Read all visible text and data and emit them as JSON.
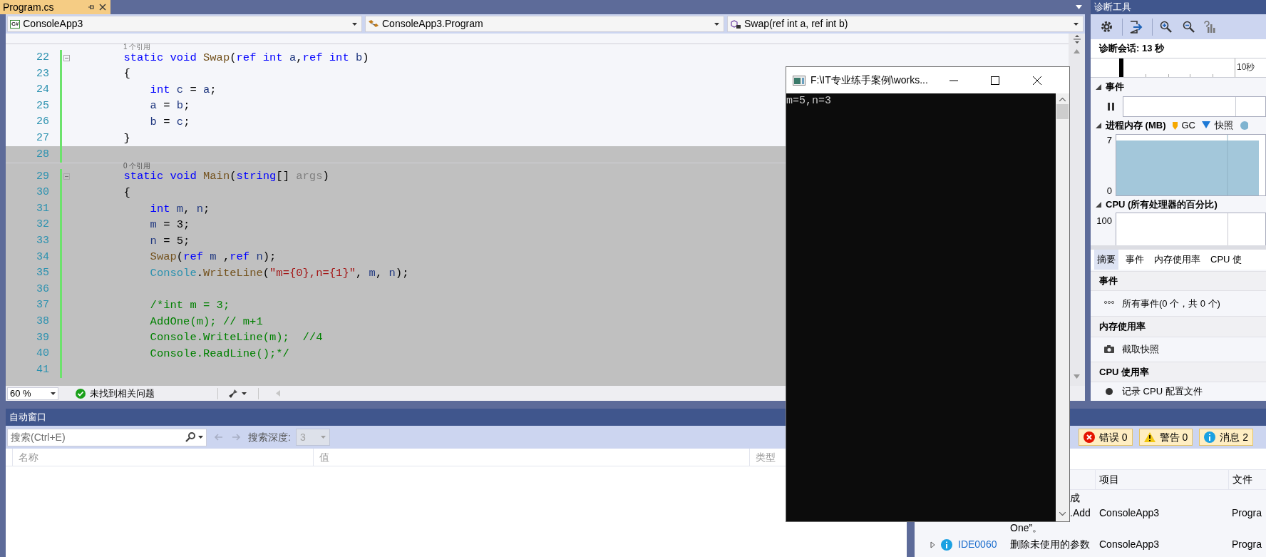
{
  "document_tabs": [
    {
      "title": "Program.cs",
      "selected": true
    }
  ],
  "navigation_bar": {
    "project_badge": "C#",
    "project": "ConsoleApp3",
    "type": "ConsoleApp3.Program",
    "member": "Swap(ref int a, ref int b)"
  },
  "editor": {
    "lines": [
      {
        "kind": "codelens",
        "text": "1 个引用",
        "selected": false
      },
      {
        "kind": "code",
        "number": "22",
        "changed": true,
        "selected": false,
        "foldable": true,
        "tokens": [
          {
            "text": "        static void ",
            "kind": "keyword"
          },
          {
            "text": "Swap",
            "kind": "method"
          },
          {
            "text": "(",
            "kind": "plain"
          },
          {
            "text": "ref int ",
            "kind": "keyword"
          },
          {
            "text": "a",
            "kind": "local"
          },
          {
            "text": ",",
            "kind": "plain"
          },
          {
            "text": "ref int ",
            "kind": "keyword"
          },
          {
            "text": "b",
            "kind": "local"
          },
          {
            "text": ")",
            "kind": "plain"
          }
        ]
      },
      {
        "kind": "code",
        "number": "23",
        "changed": true,
        "selected": false,
        "foldable": false,
        "tokens": [
          {
            "text": "        {",
            "kind": "plain"
          }
        ]
      },
      {
        "kind": "code",
        "number": "24",
        "changed": true,
        "selected": false,
        "foldable": false,
        "tokens": [
          {
            "text": "            int ",
            "kind": "keyword"
          },
          {
            "text": "c",
            "kind": "local"
          },
          {
            "text": " = ",
            "kind": "plain"
          },
          {
            "text": "a",
            "kind": "local"
          },
          {
            "text": ";",
            "kind": "plain"
          }
        ]
      },
      {
        "kind": "code",
        "number": "25",
        "changed": true,
        "selected": false,
        "foldable": false,
        "tokens": [
          {
            "text": "            a",
            "kind": "local"
          },
          {
            "text": " = ",
            "kind": "plain"
          },
          {
            "text": "b",
            "kind": "local"
          },
          {
            "text": ";",
            "kind": "plain"
          }
        ]
      },
      {
        "kind": "code",
        "number": "26",
        "changed": true,
        "selected": false,
        "foldable": false,
        "tokens": [
          {
            "text": "            b",
            "kind": "local"
          },
          {
            "text": " = ",
            "kind": "plain"
          },
          {
            "text": "c",
            "kind": "local"
          },
          {
            "text": ";",
            "kind": "plain"
          }
        ]
      },
      {
        "kind": "code",
        "number": "27",
        "changed": true,
        "selected": false,
        "foldable": false,
        "tokens": [
          {
            "text": "        }",
            "kind": "plain"
          }
        ]
      },
      {
        "kind": "code",
        "number": "28",
        "changed": true,
        "selected": true,
        "foldable": false
      },
      {
        "kind": "codelens",
        "text": "0 个引用",
        "selected": true
      },
      {
        "kind": "code",
        "number": "29",
        "changed": true,
        "selected": true,
        "foldable": true,
        "tokens": [
          {
            "text": "        static void ",
            "kind": "keyword"
          },
          {
            "text": "Main",
            "kind": "method"
          },
          {
            "text": "(",
            "kind": "plain"
          },
          {
            "text": "string",
            "kind": "keyword"
          },
          {
            "text": "[] ",
            "kind": "plain"
          },
          {
            "text": "args",
            "kind": "unused"
          },
          {
            "text": ")",
            "kind": "plain"
          }
        ]
      },
      {
        "kind": "code",
        "number": "30",
        "changed": true,
        "selected": true,
        "foldable": false,
        "tokens": [
          {
            "text": "        {",
            "kind": "plain"
          }
        ]
      },
      {
        "kind": "code",
        "number": "31",
        "changed": true,
        "selected": true,
        "foldable": false,
        "tokens": [
          {
            "text": "            int ",
            "kind": "keyword"
          },
          {
            "text": "m",
            "kind": "local"
          },
          {
            "text": ", ",
            "kind": "plain"
          },
          {
            "text": "n",
            "kind": "local"
          },
          {
            "text": ";",
            "kind": "plain"
          }
        ]
      },
      {
        "kind": "code",
        "number": "32",
        "changed": true,
        "selected": true,
        "foldable": false,
        "tokens": [
          {
            "text": "            m",
            "kind": "local"
          },
          {
            "text": " = 3;",
            "kind": "plain"
          }
        ]
      },
      {
        "kind": "code",
        "number": "33",
        "changed": true,
        "selected": true,
        "foldable": false,
        "tokens": [
          {
            "text": "            n",
            "kind": "local"
          },
          {
            "text": " = 5;",
            "kind": "plain"
          }
        ]
      },
      {
        "kind": "code",
        "number": "34",
        "changed": true,
        "selected": true,
        "foldable": false,
        "tokens": [
          {
            "text": "            Swap",
            "kind": "method"
          },
          {
            "text": "(",
            "kind": "plain"
          },
          {
            "text": "ref ",
            "kind": "keyword"
          },
          {
            "text": "m",
            "kind": "local"
          },
          {
            "text": " ,",
            "kind": "plain"
          },
          {
            "text": "ref ",
            "kind": "keyword"
          },
          {
            "text": "n",
            "kind": "local"
          },
          {
            "text": ");",
            "kind": "plain"
          }
        ]
      },
      {
        "kind": "code",
        "number": "35",
        "changed": true,
        "selected": true,
        "foldable": false,
        "tokens": [
          {
            "text": "            Console",
            "kind": "type"
          },
          {
            "text": ".",
            "kind": "plain"
          },
          {
            "text": "WriteLine",
            "kind": "method"
          },
          {
            "text": "(",
            "kind": "plain"
          },
          {
            "text": "\"m={0},n={1}\"",
            "kind": "string"
          },
          {
            "text": ", ",
            "kind": "plain"
          },
          {
            "text": "m",
            "kind": "local"
          },
          {
            "text": ", ",
            "kind": "plain"
          },
          {
            "text": "n",
            "kind": "local"
          },
          {
            "text": ");",
            "kind": "plain"
          }
        ]
      },
      {
        "kind": "code",
        "number": "36",
        "changed": true,
        "selected": true,
        "foldable": false
      },
      {
        "kind": "code",
        "number": "37",
        "changed": true,
        "selected": true,
        "foldable": false,
        "tokens": [
          {
            "text": "            /*int m = 3;",
            "kind": "comment"
          }
        ]
      },
      {
        "kind": "code",
        "number": "38",
        "changed": true,
        "selected": true,
        "foldable": false,
        "tokens": [
          {
            "text": "            AddOne(m); // m+1",
            "kind": "comment"
          }
        ]
      },
      {
        "kind": "code",
        "number": "39",
        "changed": true,
        "selected": true,
        "foldable": false,
        "tokens": [
          {
            "text": "            Console.WriteLine(m);  //4",
            "kind": "comment"
          }
        ]
      },
      {
        "kind": "code",
        "number": "40",
        "changed": true,
        "selected": true,
        "foldable": false,
        "tokens": [
          {
            "text": "            Console.ReadLine();*/",
            "kind": "comment"
          }
        ]
      },
      {
        "kind": "code",
        "number": "41",
        "changed": true,
        "selected": true,
        "foldable": false
      }
    ]
  },
  "editor_status": {
    "zoom": "60 %",
    "issues": "未找到相关问题"
  },
  "diagnostics": {
    "title": "诊断工具",
    "session": "诊断会话: 13 秒",
    "ruler_label": "10秒",
    "events": {
      "title": "事件",
      "expanded": true
    },
    "memory": {
      "title": "进程内存 (MB)",
      "expanded": true,
      "legend": [
        {
          "kind": "gc",
          "label": "GC"
        },
        {
          "kind": "snapshot",
          "label": "快照"
        },
        {
          "kind": "private"
        }
      ],
      "axis_labels": [
        "7",
        "0"
      ]
    },
    "cpu": {
      "title": "CPU (所有处理器的百分比)",
      "expanded": true,
      "tick": "100"
    },
    "tabs": [
      {
        "label": "摘要",
        "selected": true
      },
      {
        "label": "事件",
        "selected": false
      },
      {
        "label": "内存使用率",
        "selected": false
      },
      {
        "label": "CPU 使",
        "selected": false
      }
    ],
    "summary": [
      {
        "title": "事件",
        "action": {
          "kind": "events",
          "label": "所有事件(0 个，共 0 个)"
        }
      },
      {
        "title": "内存使用率",
        "action": {
          "kind": "snapshot",
          "label": "截取快照"
        }
      },
      {
        "title": "CPU 使用率",
        "action": {
          "kind": "record",
          "label": "记录 CPU 配置文件"
        }
      }
    ]
  },
  "autos": {
    "title": "自动窗口",
    "search": {
      "placeholder": "搜索(Ctrl+E)"
    },
    "depth_label": "搜索深度:",
    "depth": {
      "value": "3",
      "disabled": true
    },
    "columns": [
      "名称",
      "值",
      "类型"
    ]
  },
  "error_list": {
    "filters": [
      {
        "kind": "error",
        "label": "错误 0",
        "selected": true
      },
      {
        "kind": "warning",
        "label": "警告 0",
        "selected": true
      },
      {
        "kind": "message",
        "label": "消息 2",
        "selected": true
      }
    ],
    "columns": [
      "项目",
      "文件"
    ],
    "rows": [
      {
        "description": [
          {
            "text": "成",
            "partial": true
          },
          {
            "text": ".Add",
            "partial": true
          },
          {
            "text": "One”。",
            "partial": false
          }
        ],
        "project": "ConsoleApp3",
        "file": "Progra"
      },
      {
        "kind": "message",
        "code": "IDE0060",
        "expanded": false,
        "description": [
          {
            "text": "删除未使用的参数",
            "partial": false
          }
        ],
        "project": "ConsoleApp3",
        "file": "Progra"
      }
    ]
  },
  "console": {
    "title": "F:\\IT专业练手案例\\works...",
    "output": "m=5,n=3"
  }
}
